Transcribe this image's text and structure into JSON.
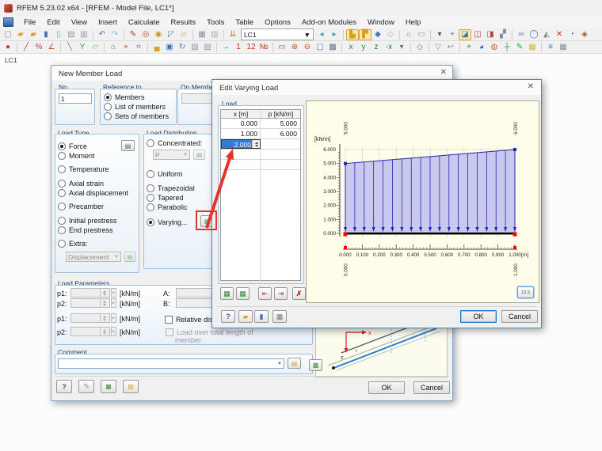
{
  "window": {
    "title": "RFEM 5.23.02 x64 - [RFEM - Model File, LC1*]"
  },
  "menu": {
    "items": [
      "File",
      "Edit",
      "View",
      "Insert",
      "Calculate",
      "Results",
      "Tools",
      "Table",
      "Options",
      "Add-on Modules",
      "Window",
      "Help"
    ]
  },
  "toolbar_main": {
    "load_case_selector": "LC1",
    "icons": [
      {
        "n": "new-file",
        "g": "▢",
        "c": "#8f8f8f"
      },
      {
        "n": "open-folder",
        "g": "▰",
        "c": "#e0a330"
      },
      {
        "n": "open-model",
        "g": "▰",
        "c": "#d89a28"
      },
      {
        "n": "save",
        "g": "▮",
        "c": "#4472a8"
      },
      {
        "n": "save-as",
        "g": "▯",
        "c": "#8a9aab"
      },
      {
        "n": "print",
        "g": "▤",
        "c": "#8f99a2"
      },
      {
        "n": "print-preview",
        "g": "▥",
        "c": "#8f99a2"
      },
      {
        "s": 1
      },
      {
        "n": "undo",
        "g": "↶",
        "c": "#4a78b0"
      },
      {
        "n": "redo",
        "g": "↷",
        "c": "#9ab0c8"
      },
      {
        "s": 1
      },
      {
        "n": "edit-marker",
        "g": "✎",
        "c": "#c03028"
      },
      {
        "n": "zoom-find",
        "g": "◎",
        "c": "#c05030"
      },
      {
        "n": "render-target",
        "g": "◉",
        "c": "#d09020"
      },
      {
        "n": "select-cursor",
        "g": "◸",
        "c": "#5080b0"
      },
      {
        "n": "project-folder",
        "g": "▱",
        "c": "#d8a838"
      },
      {
        "s": 1
      },
      {
        "n": "table-show",
        "g": "▦",
        "c": "#8a9098"
      },
      {
        "n": "table-hide",
        "g": "▥",
        "c": "#a8aeb4"
      },
      {
        "s": 1
      },
      {
        "n": "load-cases",
        "g": "⇊",
        "c": "#c08818"
      },
      {
        "combo": 1
      },
      {
        "n": "previous-load-case",
        "g": "◂",
        "c": "#38a0a8"
      },
      {
        "n": "next-load-case",
        "g": "▸",
        "c": "#38a0a8"
      },
      {
        "s": 1
      },
      {
        "n": "new-load-case",
        "g": "▙",
        "c": "#d8a020",
        "h": 1
      },
      {
        "n": "load-case-manager",
        "g": "▛",
        "c": "#d8a020",
        "h": 1
      },
      {
        "n": "show-loads",
        "g": "◆",
        "c": "#4878b8"
      },
      {
        "n": "show-results",
        "g": "◇",
        "c": "#98a8b8"
      },
      {
        "s": 1
      },
      {
        "n": "wind-generator",
        "g": "☼",
        "c": "#80889a"
      },
      {
        "n": "vehicle-loads",
        "g": "▭",
        "c": "#8890a0"
      },
      {
        "s": 1
      },
      {
        "n": "snap-settings",
        "g": "▾",
        "c": "#405870"
      },
      {
        "n": "grid-settings",
        "g": "+",
        "c": "#3878c0"
      },
      {
        "n": "work-plane",
        "g": "◪",
        "c": "#3878c0",
        "h": 1
      },
      {
        "n": "plane-xz",
        "g": "◫",
        "c": "#b04838"
      },
      {
        "n": "plane-yz",
        "g": "◨",
        "c": "#b04838"
      },
      {
        "n": "guidelines",
        "g": "▞",
        "c": "#8090a0"
      },
      {
        "s": 1
      },
      {
        "n": "chain-link",
        "g": "∞",
        "c": "#607890"
      },
      {
        "n": "sphere-view",
        "g": "◯",
        "c": "#3070b0"
      },
      {
        "n": "mirror-tool",
        "g": "◭",
        "c": "#708090"
      },
      {
        "n": "delete-selection",
        "g": "✕",
        "c": "#c03028"
      },
      {
        "n": "spiral-tool",
        "g": "◔",
        "c": "#3060a8"
      },
      {
        "n": "addon-modules",
        "g": "◈",
        "c": "#b05030"
      }
    ]
  },
  "toolbar_view": {
    "icons": [
      {
        "n": "new-node",
        "g": "●",
        "c": "#c04030"
      },
      {
        "s": 1
      },
      {
        "n": "new-line",
        "g": "╱",
        "c": "#c04030"
      },
      {
        "n": "divide-line",
        "g": "%",
        "c": "#c04030"
      },
      {
        "n": "polyline",
        "g": "∠",
        "c": "#c05030"
      },
      {
        "s": 1
      },
      {
        "n": "new-member",
        "g": "╲",
        "c": "#30a040"
      },
      {
        "n": "member-set",
        "g": "Y",
        "c": "#30a040"
      },
      {
        "n": "new-surface",
        "g": "▱",
        "c": "#80b890"
      },
      {
        "s": 1
      },
      {
        "n": "nodal-support",
        "g": "⌂",
        "c": "#607080"
      },
      {
        "n": "member-hinge",
        "g": "⌖",
        "c": "#b06030"
      },
      {
        "n": "select-frame",
        "g": "⌗",
        "c": "#708090"
      },
      {
        "s": 1
      },
      {
        "n": "new-block",
        "g": "▄",
        "c": "#d8a828"
      },
      {
        "n": "selection-box",
        "g": "▣",
        "c": "#4070b0"
      },
      {
        "n": "rotate-tool",
        "g": "↻",
        "c": "#607890"
      },
      {
        "n": "new-solid",
        "g": "▧",
        "c": "#9098a8"
      },
      {
        "n": "copy-solid",
        "g": "▨",
        "c": "#9098a8"
      },
      {
        "s": 1
      },
      {
        "n": "move-copy",
        "g": "→",
        "c": "#3068b0"
      },
      {
        "n": "numbering-one",
        "g": "1",
        "c": "#c03028"
      },
      {
        "n": "numbering-all",
        "g": "12",
        "c": "#c03028"
      },
      {
        "n": "renumber",
        "g": "№",
        "c": "#c03028"
      },
      {
        "s": 1
      },
      {
        "n": "zoom-window",
        "g": "▭",
        "c": "#c05030"
      },
      {
        "n": "zoom-in",
        "g": "⊕",
        "c": "#c05030"
      },
      {
        "n": "zoom-out",
        "g": "⊖",
        "c": "#c05030"
      },
      {
        "n": "wireframe-view",
        "g": "▢",
        "c": "#607890"
      },
      {
        "n": "shaded-view",
        "g": "▩",
        "c": "#607890"
      },
      {
        "s": 1
      },
      {
        "n": "view-x",
        "g": "x",
        "c": "#208838"
      },
      {
        "n": "view-y",
        "g": "y",
        "c": "#208838"
      },
      {
        "n": "view-z",
        "g": "z",
        "c": "#208838"
      },
      {
        "n": "view-minus-x",
        "g": "-x",
        "c": "#208838"
      },
      {
        "n": "view-select",
        "g": "▾",
        "c": "#607890"
      },
      {
        "s": 1
      },
      {
        "n": "isometric-view",
        "g": "◇",
        "c": "#607890"
      },
      {
        "s": 1
      },
      {
        "n": "filter-view",
        "g": "▽",
        "c": "#8090a0"
      },
      {
        "n": "previous-view",
        "g": "↩",
        "c": "#8090a0"
      },
      {
        "s": 1
      },
      {
        "n": "show-axes",
        "g": "+",
        "c": "#208838"
      },
      {
        "n": "render-colors",
        "g": "◕",
        "c": "#3068b0"
      },
      {
        "n": "display-properties",
        "g": "◍",
        "c": "#c07030"
      },
      {
        "n": "move-nodes",
        "g": "┼",
        "c": "#30a040"
      },
      {
        "n": "draw-tool",
        "g": "✎",
        "c": "#30a040"
      },
      {
        "n": "control-panel",
        "g": "▦",
        "c": "#d8b838"
      },
      {
        "s": 1
      },
      {
        "n": "visibility-mode",
        "g": "≡",
        "c": "#4070b0"
      },
      {
        "n": "tables-toggle",
        "g": "▦",
        "c": "#8090a0"
      }
    ]
  },
  "workspace": {
    "view_label": "LC1"
  },
  "new_member_load": {
    "title": "New Member Load",
    "close_glyph": "✕",
    "no_group": {
      "label": "No.",
      "value": "1"
    },
    "reference_group": {
      "label": "Reference to",
      "options": [
        {
          "label": "Members",
          "selected": true
        },
        {
          "label": "List of members",
          "selected": false
        },
        {
          "label": "Sets of members",
          "selected": false
        }
      ]
    },
    "on_members_group": {
      "label": "On Members No.",
      "value": ""
    },
    "load_type_group": {
      "label": "Load Type",
      "options": [
        {
          "label": "Force",
          "selected": true
        },
        {
          "label": "Moment",
          "selected": false
        },
        {
          "label": "Temperature",
          "selected": false
        },
        {
          "label": "Axial strain",
          "selected": false
        },
        {
          "label": "Axial displacement",
          "selected": false
        },
        {
          "label": "Precamber",
          "selected": false
        },
        {
          "label": "Initial prestress",
          "selected": false
        },
        {
          "label": "End prestress",
          "selected": false
        },
        {
          "label": "Extra:",
          "selected": false
        }
      ],
      "extra_value": "Displacement"
    },
    "load_distribution_group": {
      "label": "Load Distribution",
      "options": [
        {
          "label": "Concentrated:",
          "selected": false
        },
        {
          "label": "Uniform",
          "selected": false
        },
        {
          "label": "Trapezoidal",
          "selected": false
        },
        {
          "label": "Tapered",
          "selected": false
        },
        {
          "label": "Parabolic",
          "selected": false
        },
        {
          "label": "Varying...",
          "selected": true
        }
      ],
      "concentrated_value": "P"
    },
    "load_parameters_group": {
      "label": "Load Parameters",
      "p1_label": "p1:",
      "p2_label": "p2:",
      "p1b_label": "p1:",
      "p2b_label": "p2:",
      "unit": "[kN/m]",
      "a_label": "A:",
      "b_label": "B:",
      "relative_distance_label": "Relative distance",
      "load_over_label": "Load over total length of",
      "load_over_label2": "member"
    },
    "comment_group": {
      "label": "Comment",
      "value": ""
    },
    "buttons": {
      "ok": "OK",
      "cancel": "Cancel"
    }
  },
  "edit_varying_load": {
    "title": "Edit Varying Load",
    "close_glyph": "✕",
    "load_group": {
      "label": "Load",
      "columns": [
        "x [m]",
        "p [kN/m]"
      ],
      "rows": [
        [
          "0.000",
          "5.000"
        ],
        [
          "1.000",
          "6.000"
        ]
      ],
      "editing_value": "2.000"
    },
    "chart_data": {
      "type": "area",
      "x": [
        0.0,
        1.0
      ],
      "values": [
        5.0,
        6.0
      ],
      "ylabel": "[kN/m]",
      "xlabel": "[m]",
      "xlim": [
        0,
        1
      ],
      "ylim": [
        0,
        6
      ],
      "y_tick_labels": [
        "0.000",
        "1.000",
        "2.000",
        "3.000",
        "4.000",
        "5.000",
        "6.000"
      ],
      "x_tick_labels": [
        "0.000",
        "0.100",
        "0.200",
        "0.300",
        "0.400",
        "0.500",
        "0.600",
        "0.700",
        "0.800",
        "0.900",
        "1.000"
      ],
      "value_labels": [
        "5.000",
        "6.000"
      ],
      "position_labels": [
        "0.000",
        "1.000"
      ],
      "hatch_segments": 18,
      "grid": true,
      "legend": false,
      "fill_color": "#c9c9f0",
      "line_color": "#2525ac",
      "beam_color": "#000000",
      "end_marker_color": "#ff0000"
    },
    "display_button": "12.3",
    "buttons": {
      "ok": "OK",
      "cancel": "Cancel"
    }
  },
  "annotations": {
    "highlight_color": "#e0362e"
  }
}
